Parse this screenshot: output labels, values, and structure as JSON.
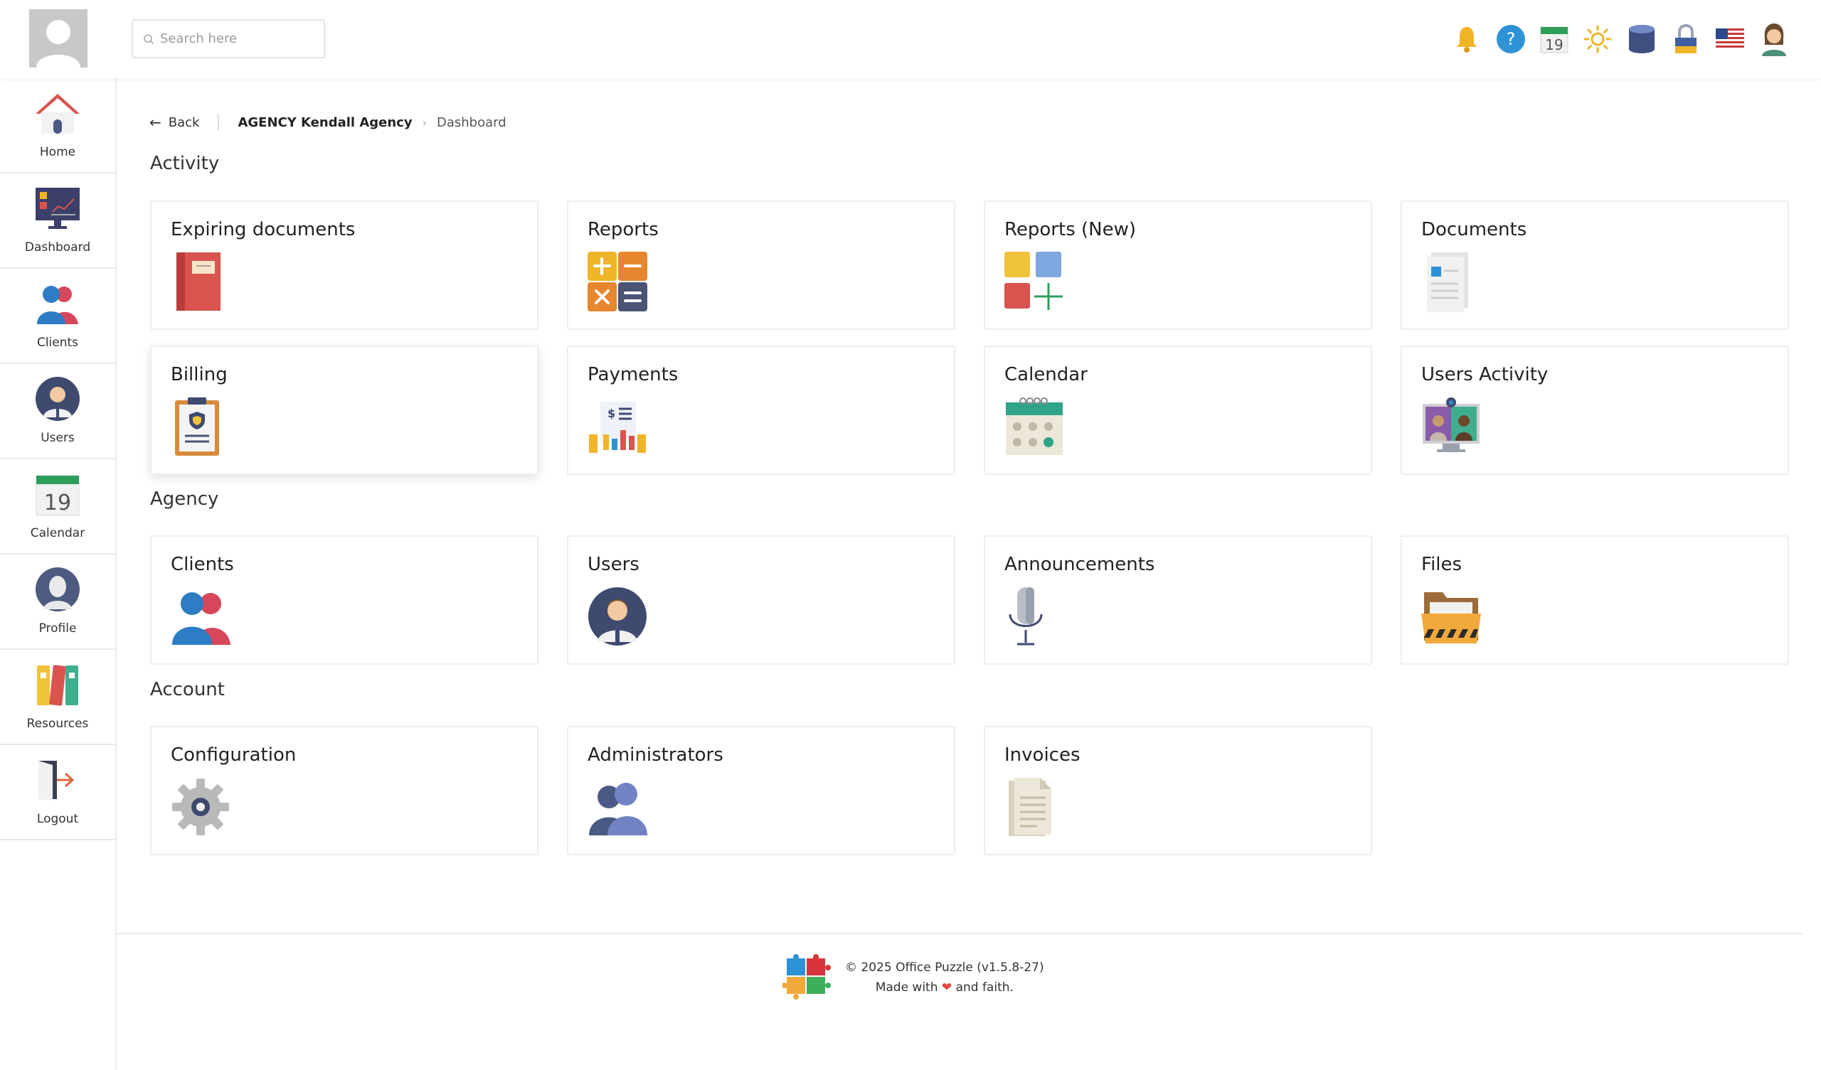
{
  "header": {
    "search_placeholder": "Search here",
    "calendar_day": "19",
    "icons": [
      "bell-icon",
      "help-icon",
      "calendar-icon",
      "theme-sun-icon",
      "database-icon",
      "lock-icon",
      "us-flag-icon",
      "user-avatar-icon"
    ]
  },
  "sidebar": {
    "items": [
      {
        "label": "Home",
        "icon": "home-icon"
      },
      {
        "label": "Dashboard",
        "icon": "dashboard-icon"
      },
      {
        "label": "Clients",
        "icon": "clients-icon"
      },
      {
        "label": "Users",
        "icon": "users-icon"
      },
      {
        "label": "Calendar",
        "icon": "calendar-icon",
        "day": "19"
      },
      {
        "label": "Profile",
        "icon": "profile-icon"
      },
      {
        "label": "Resources",
        "icon": "resources-icon"
      },
      {
        "label": "Logout",
        "icon": "logout-icon"
      }
    ]
  },
  "breadcrumb": {
    "back": "Back",
    "agency": "AGENCY Kendall Agency",
    "current": "Dashboard"
  },
  "sections": {
    "activity": {
      "title": "Activity",
      "cards": [
        "Expiring documents",
        "Reports",
        "Reports (New)",
        "Documents",
        "Billing",
        "Payments",
        "Calendar",
        "Users Activity"
      ]
    },
    "agency": {
      "title": "Agency",
      "cards": [
        "Clients",
        "Users",
        "Announcements",
        "Files"
      ]
    },
    "account": {
      "title": "Account",
      "cards": [
        "Configuration",
        "Administrators",
        "Invoices"
      ]
    }
  },
  "footer": {
    "copyright": "© 2025 Office Puzzle (v1.5.8-27)",
    "made_with": "Made with",
    "and_faith": "and faith."
  },
  "colors": {
    "accent_red": "#d9534f",
    "accent_blue": "#2f80c9",
    "sidebar_border": "#e8e8e8"
  }
}
